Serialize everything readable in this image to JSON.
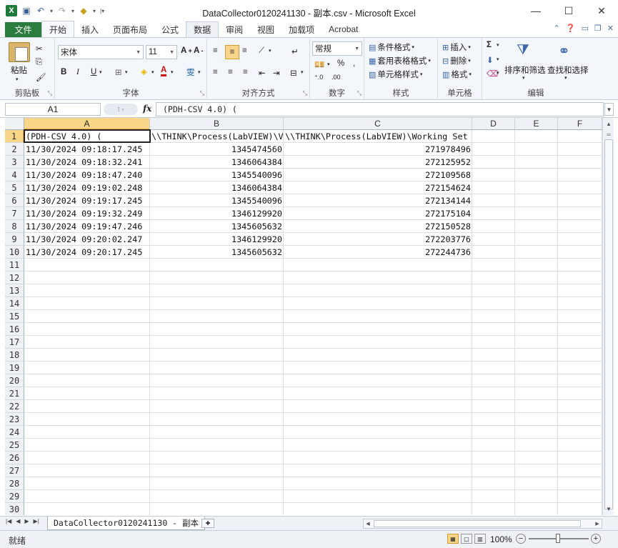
{
  "window": {
    "title": "DataCollector0120241130 - 副本.csv - Microsoft Excel",
    "logo": "X"
  },
  "tabs": {
    "file": "文件",
    "home": "开始",
    "insert": "插入",
    "page_layout": "页面布局",
    "formulas": "公式",
    "data": "数据",
    "review": "审阅",
    "view": "视图",
    "addins": "加载项",
    "acrobat": "Acrobat"
  },
  "ribbon": {
    "clipboard": {
      "label": "剪贴板",
      "paste": "粘贴"
    },
    "font": {
      "label": "字体",
      "name": "宋体",
      "size": "11"
    },
    "alignment": {
      "label": "对齐方式"
    },
    "number": {
      "label": "数字",
      "format": "常规"
    },
    "styles": {
      "label": "样式",
      "cond": "条件格式",
      "table": "套用表格格式",
      "cell": "单元格样式"
    },
    "cells": {
      "label": "单元格",
      "insert": "插入",
      "delete": "删除",
      "format": "格式"
    },
    "editing": {
      "label": "编辑",
      "sort": "排序和筛选",
      "find": "查找和选择"
    }
  },
  "formula_bar": {
    "name_box": "A1",
    "fx": "fx",
    "content": "(PDH-CSV 4.0) ("
  },
  "sheet": {
    "columns": [
      "A",
      "B",
      "C",
      "D",
      "E",
      "F"
    ],
    "row_numbers": [
      "1",
      "2",
      "3",
      "4",
      "5",
      "6",
      "7",
      "8",
      "9",
      "10",
      "11",
      "12",
      "13",
      "14",
      "15",
      "16",
      "17",
      "18",
      "19",
      "20",
      "21",
      "22",
      "23",
      "24",
      "25",
      "26",
      "27",
      "28",
      "29",
      "30"
    ],
    "rows": [
      [
        "(PDH-CSV 4.0) (",
        "\\\\THINK\\Process(LabVIEW)\\Vii",
        "\\\\THINK\\Process(LabVIEW)\\Working Set"
      ],
      [
        "11/30/2024 09:18:17.245",
        "1345474560",
        "271978496"
      ],
      [
        "11/30/2024 09:18:32.241",
        "1346064384",
        "272125952"
      ],
      [
        "11/30/2024 09:18:47.240",
        "1345540096",
        "272109568"
      ],
      [
        "11/30/2024 09:19:02.248",
        "1346064384",
        "272154624"
      ],
      [
        "11/30/2024 09:19:17.245",
        "1345540096",
        "272134144"
      ],
      [
        "11/30/2024 09:19:32.249",
        "1346129920",
        "272175104"
      ],
      [
        "11/30/2024 09:19:47.246",
        "1345605632",
        "272150528"
      ],
      [
        "11/30/2024 09:20:02.247",
        "1346129920",
        "272203776"
      ],
      [
        "11/30/2024 09:20:17.245",
        "1345605632",
        "272244736"
      ]
    ]
  },
  "sheet_tab": {
    "name": "DataCollector0120241130 - 副本"
  },
  "status": {
    "ready": "就绪",
    "zoom": "100%"
  }
}
